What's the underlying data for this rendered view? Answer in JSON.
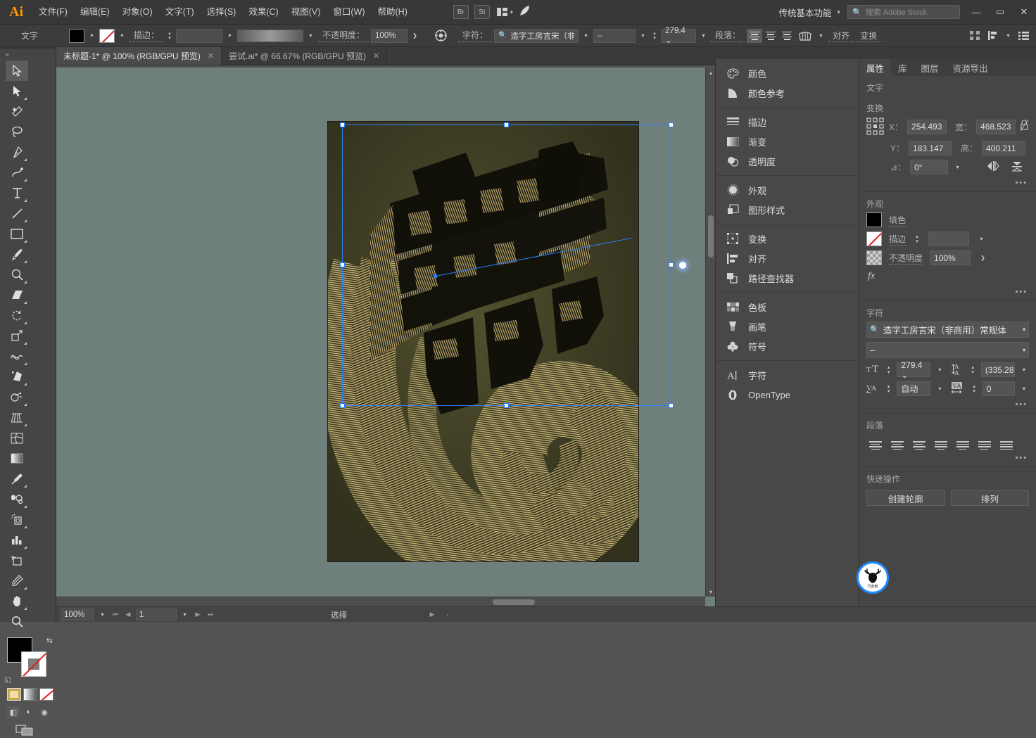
{
  "app": {
    "logo": "Ai"
  },
  "menubar": {
    "items": [
      {
        "label": "文件(F)"
      },
      {
        "label": "编辑(E)"
      },
      {
        "label": "对象(O)"
      },
      {
        "label": "文字(T)"
      },
      {
        "label": "选择(S)"
      },
      {
        "label": "效果(C)"
      },
      {
        "label": "视图(V)"
      },
      {
        "label": "窗口(W)"
      },
      {
        "label": "帮助(H)"
      }
    ],
    "bridge_label": "Br",
    "stock_label": "St",
    "workspace": "传统基本功能",
    "search_placeholder": "搜索 Adobe Stock",
    "window_minimize": "—",
    "window_maximize": "▭",
    "window_close": "✕"
  },
  "controlbar": {
    "mode_label": "文字",
    "fill_color": "#000000",
    "stroke_label": "描边：",
    "stroke_weight": "",
    "opacity_label": "不透明度：",
    "opacity_value": "100%",
    "char_label": "字符：",
    "font_family": "造字工房言宋（非…",
    "font_style": "–",
    "font_size": "279.4 ⌄",
    "paragraph_label": "段落：",
    "align_label": "对齐",
    "transform_label": "变换"
  },
  "tabs": [
    {
      "title": "未标题-1* @ 100% (RGB/GPU 预览)",
      "active": true,
      "close": "✕"
    },
    {
      "title": "尝试.ai* @ 66.67% (RGB/GPU 预览)",
      "active": false,
      "close": "✕"
    }
  ],
  "toolbar": {
    "collapse": "«",
    "tools": [
      {
        "name": "selection-tool",
        "active": true
      },
      {
        "name": "direct-selection-tool",
        "active": false
      },
      {
        "name": "magic-wand-tool",
        "active": false
      },
      {
        "name": "lasso-tool",
        "active": false
      },
      {
        "name": "pen-tool",
        "active": false
      },
      {
        "name": "curvature-tool",
        "active": false
      },
      {
        "name": "type-tool",
        "active": false
      },
      {
        "name": "line-segment-tool",
        "active": false
      },
      {
        "name": "rectangle-tool",
        "active": false
      },
      {
        "name": "paintbrush-tool",
        "active": false
      },
      {
        "name": "shaper-tool",
        "active": false
      },
      {
        "name": "eraser-tool",
        "active": false
      },
      {
        "name": "rotate-tool",
        "active": false
      },
      {
        "name": "scale-tool",
        "active": false
      },
      {
        "name": "width-tool",
        "active": false
      },
      {
        "name": "free-transform-tool",
        "active": false
      },
      {
        "name": "shape-builder-tool",
        "active": false
      },
      {
        "name": "perspective-grid-tool",
        "active": false
      },
      {
        "name": "mesh-tool",
        "active": false
      },
      {
        "name": "gradient-tool",
        "active": false
      },
      {
        "name": "eyedropper-tool",
        "active": false
      },
      {
        "name": "blend-tool",
        "active": false
      },
      {
        "name": "symbol-sprayer-tool",
        "active": false
      },
      {
        "name": "column-graph-tool",
        "active": false
      },
      {
        "name": "artboard-tool",
        "active": false
      },
      {
        "name": "slice-tool",
        "active": false
      },
      {
        "name": "hand-tool",
        "active": false
      },
      {
        "name": "zoom-tool",
        "active": false
      }
    ],
    "fill_color": "#000000",
    "stroke_none": true,
    "color_modes": [
      "color-mode",
      "gradient-mode",
      "none-mode"
    ],
    "draw_modes": [
      "draw-normal",
      "draw-behind",
      "draw-inside"
    ],
    "screen_mode": "change-screen-mode"
  },
  "canvas": {
    "artwork_title": "鹿",
    "background_color": "#3e3d24",
    "line_color": "#d8c07a",
    "canvas_color": "#6f7f7b",
    "selection_color": "#2a7fff"
  },
  "dock": {
    "groups": [
      {
        "items": [
          {
            "label": "颜色",
            "icon": "palette-icon"
          },
          {
            "label": "颜色参考",
            "icon": "color-guide-icon"
          }
        ]
      },
      {
        "items": [
          {
            "label": "描边",
            "icon": "stroke-icon"
          },
          {
            "label": "渐变",
            "icon": "gradient-icon"
          },
          {
            "label": "透明度",
            "icon": "transparency-icon"
          }
        ]
      },
      {
        "items": [
          {
            "label": "外观",
            "icon": "appearance-icon"
          },
          {
            "label": "图形样式",
            "icon": "graphic-styles-icon"
          }
        ]
      },
      {
        "items": [
          {
            "label": "变换",
            "icon": "transform-icon"
          },
          {
            "label": "对齐",
            "icon": "align-icon"
          },
          {
            "label": "路径查找器",
            "icon": "pathfinder-icon"
          }
        ]
      },
      {
        "items": [
          {
            "label": "色板",
            "icon": "swatches-icon"
          },
          {
            "label": "画笔",
            "icon": "brushes-icon"
          },
          {
            "label": "符号",
            "icon": "symbols-icon"
          }
        ]
      },
      {
        "items": [
          {
            "label": "字符",
            "icon": "character-icon"
          },
          {
            "label": "OpenType",
            "icon": "opentype-icon"
          }
        ]
      }
    ]
  },
  "properties": {
    "tabs": [
      {
        "label": "属性",
        "active": true
      },
      {
        "label": "库",
        "active": false
      },
      {
        "label": "图层",
        "active": false
      },
      {
        "label": "资源导出",
        "active": false
      }
    ],
    "type_section": "文字",
    "transform_section": "变换",
    "x_label": "X：",
    "x_value": "254.493",
    "y_label": "Y：",
    "y_value": "183.147",
    "w_label": "宽：",
    "w_value": "468.523",
    "h_label": "高：",
    "h_value": "400.211",
    "angle_label": "⊿：",
    "angle_value": "0°",
    "appearance_section": "外观",
    "fill_label": "填色",
    "stroke_label": "描边",
    "stroke_weight": "",
    "opacity_label": "不透明度",
    "opacity_value": "100%",
    "fx_label": "fx",
    "character_section": "字符",
    "font_family": "造字工房言宋（非商用）常规体",
    "font_style": "–",
    "font_size": "279.4 ⌄",
    "leading": "(335.28",
    "kerning": "自动",
    "tracking": "0",
    "paragraph_section": "段落",
    "quick_actions_section": "快速操作",
    "qa_outline": "创建轮廓",
    "qa_arrange": "排列",
    "more_dots": "•••"
  },
  "statusbar": {
    "zoom": "100%",
    "page": "1",
    "status": "选择"
  }
}
